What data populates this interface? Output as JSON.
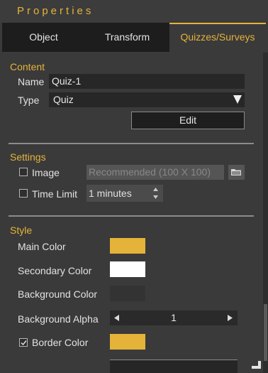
{
  "panel": {
    "title": "Properties",
    "tabs": [
      {
        "label": "Object"
      },
      {
        "label": "Transform"
      },
      {
        "label": "Quizzes/Surveys"
      }
    ]
  },
  "content": {
    "title": "Content",
    "name_label": "Name",
    "name_value": "Quiz-1",
    "type_label": "Type",
    "type_value": "Quiz",
    "edit_label": "Edit"
  },
  "settings": {
    "title": "Settings",
    "image_label": "Image",
    "image_placeholder": "Recommended (100 X 100)",
    "image_checked": false,
    "time_limit_label": "Time Limit",
    "time_limit_value": "1 minutes",
    "time_limit_checked": false
  },
  "style": {
    "title": "Style",
    "main_color_label": "Main Color",
    "main_color": "#e5b33a",
    "secondary_color_label": "Secondary Color",
    "secondary_color": "#ffffff",
    "background_color_label": "Background Color",
    "background_color": "#333333",
    "background_alpha_label": "Background Alpha",
    "background_alpha_value": "1",
    "border_color_label": "Border Color",
    "border_color": "#e5b33a",
    "border_color_checked": true
  },
  "icons": {
    "folder": "folder-icon",
    "dropdown": "triangle-down-icon",
    "spinner": "spinner-arrows-icon",
    "resize": "resize-grip-icon"
  }
}
